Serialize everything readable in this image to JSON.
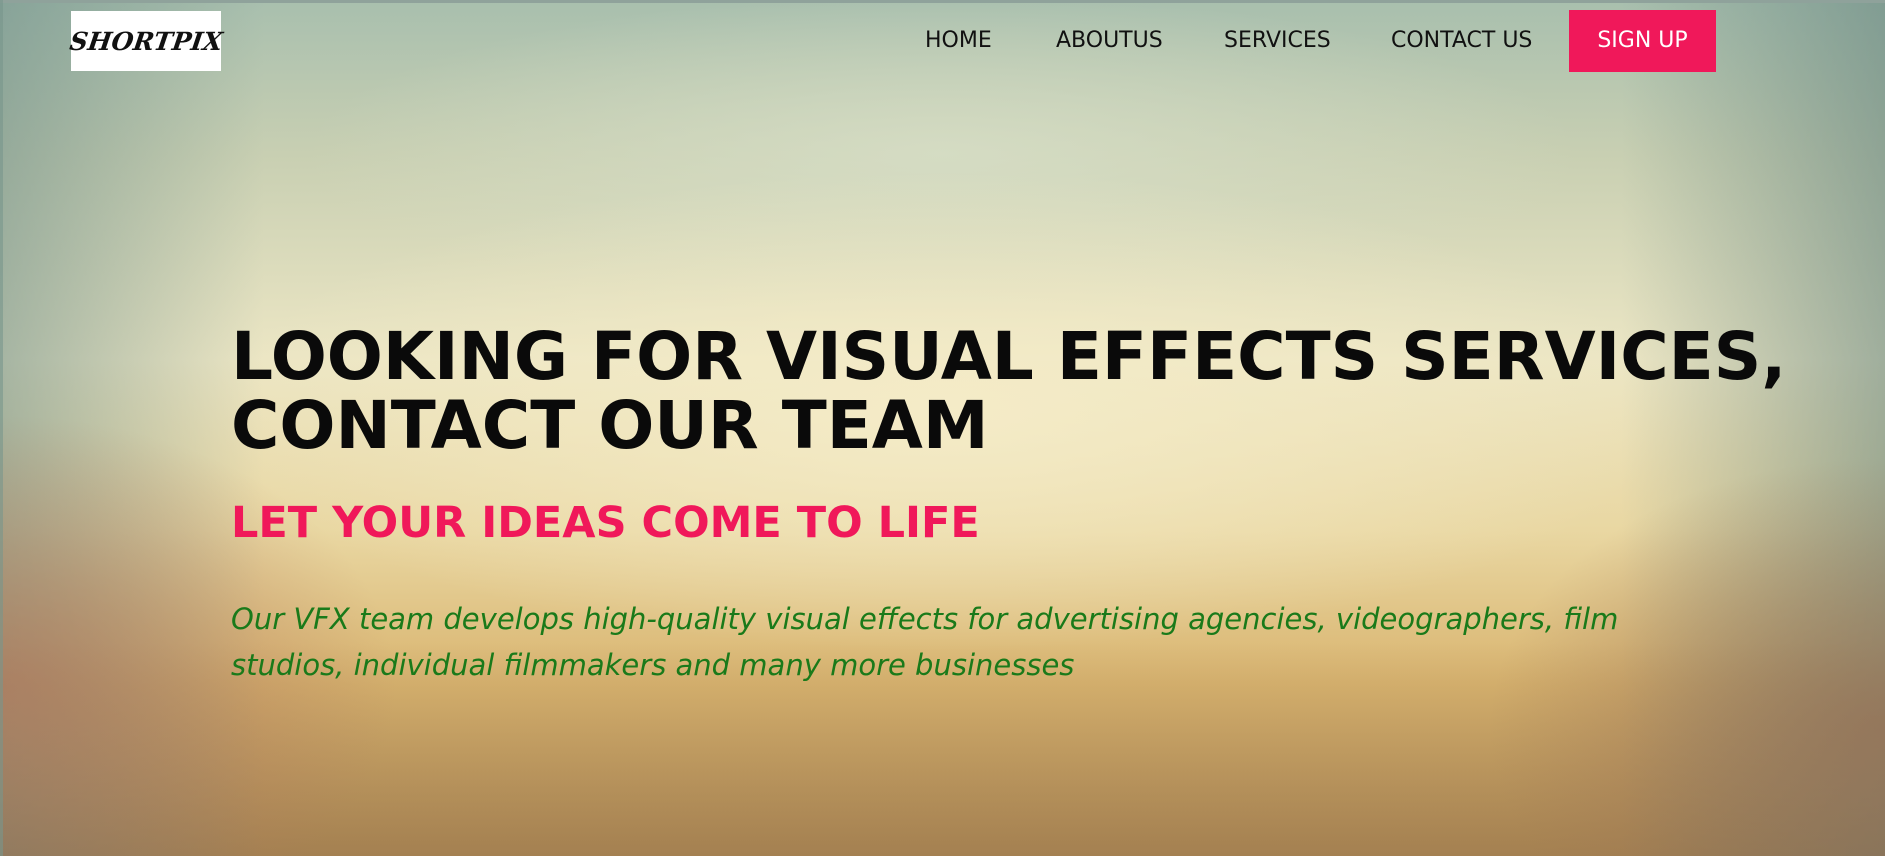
{
  "brand": {
    "logo_text": "SHORTPIX"
  },
  "nav": {
    "items": [
      {
        "label": "HOME"
      },
      {
        "label": "ABOUTUS"
      },
      {
        "label": "SERVICES"
      },
      {
        "label": "CONTACT US"
      }
    ],
    "signup_label": "SIGN UP"
  },
  "hero": {
    "headline_line1": "LOOKING FOR VISUAL EFFECTS SERVICES,",
    "headline_line2": "CONTACT OUR TEAM",
    "tagline": "LET YOUR IDEAS COME TO LIFE",
    "description": "Our VFX team develops high-quality visual effects for advertising agencies, videographers, film studios, individual filmmakers and many more businesses"
  },
  "colors": {
    "accent": "#f0185a",
    "description_text": "#1a7a1a",
    "headline_text": "#0a0a0a",
    "logo_background": "#ffffff"
  }
}
